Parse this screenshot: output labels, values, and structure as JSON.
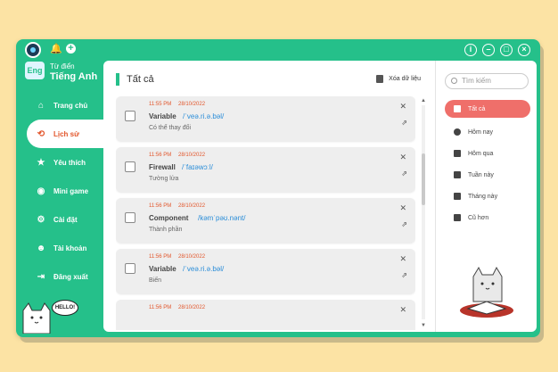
{
  "app": {
    "subtitle": "Từ điển",
    "name": "Tiếng Anh",
    "logo_text": "Eng"
  },
  "sidebar": {
    "items": [
      {
        "label": "Trang chủ",
        "icon": "home-icon"
      },
      {
        "label": "Lịch sử",
        "icon": "history-icon",
        "active": true
      },
      {
        "label": "Yêu thích",
        "icon": "star-icon"
      },
      {
        "label": "Mini game",
        "icon": "gamepad-icon"
      },
      {
        "label": "Cài đặt",
        "icon": "gear-icon"
      },
      {
        "label": "Tài khoản",
        "icon": "user-icon"
      },
      {
        "label": "Đăng xuất",
        "icon": "logout-icon"
      }
    ],
    "mascot_text": "HELLO!"
  },
  "content": {
    "title": "Tất cả",
    "clear_label": "Xóa dữ liệu",
    "entries": [
      {
        "time": "11:55 PM",
        "date": "28/10/2022",
        "word": "Variable",
        "ipa": "/ˈveə.ri.ə.bəl/",
        "meaning": "Có thể thay đổi"
      },
      {
        "time": "11:56 PM",
        "date": "28/10/2022",
        "word": "Firewall",
        "ipa": "/ˈfaɪəwɔːl/",
        "meaning": "Tường lửa"
      },
      {
        "time": "11:56 PM",
        "date": "28/10/2022",
        "word": "Component",
        "ipa": "/kəmˈpəʊ.nənt/",
        "meaning": "Thành phần"
      },
      {
        "time": "11:56 PM",
        "date": "28/10/2022",
        "word": "Variable",
        "ipa": "/ˈveə.ri.ə.bəl/",
        "meaning": "Biến"
      },
      {
        "time": "11:56 PM",
        "date": "28/10/2022",
        "word": "",
        "ipa": "",
        "meaning": ""
      }
    ]
  },
  "filters": {
    "search_placeholder": "Tìm kiếm",
    "items": [
      {
        "label": "Tất cả",
        "active": true
      },
      {
        "label": "Hôm nay"
      },
      {
        "label": "Hôm qua"
      },
      {
        "label": "Tuần này"
      },
      {
        "label": "Tháng này"
      },
      {
        "label": "Cũ hơn"
      }
    ]
  },
  "colors": {
    "accent": "#25c08a",
    "active_nav": "#e2552a",
    "active_filter": "#ef6f6a",
    "ipa": "#2a8dd8",
    "background": "#fce3a4"
  }
}
